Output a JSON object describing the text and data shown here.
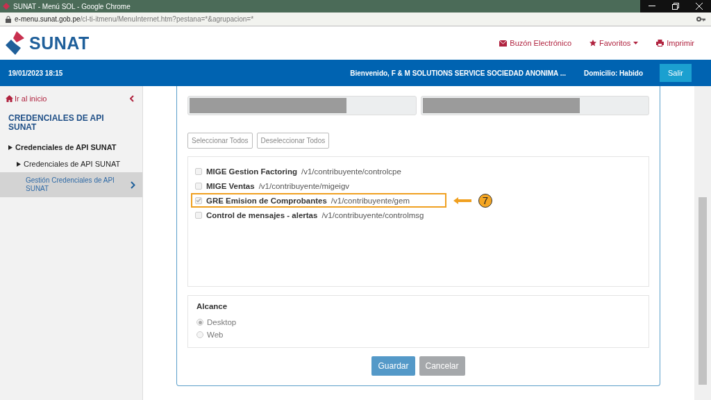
{
  "window": {
    "title": "SUNAT - Menú SOL - Google Chrome",
    "url_host": "e-menu.sunat.gob.pe",
    "url_path": "/cl-ti-itmenu/MenuInternet.htm?pestana=*&agrupacion=*"
  },
  "header": {
    "logo": "SUNAT",
    "links": [
      {
        "kind": "mail",
        "label": "Buzón Electrónico"
      },
      {
        "kind": "star",
        "label": "Favoritos"
      },
      {
        "kind": "print",
        "label": "Imprimir"
      }
    ]
  },
  "bar": {
    "datetime": "19/01/2023 18:15",
    "welcome": "Bienvenido, F & M SOLUTIONS SERVICE SOCIEDAD ANONIMA ...",
    "domicilio": "Domicilio: Habido",
    "logout": "Salir"
  },
  "sidebar": {
    "home": "Ir al inicio",
    "title": "CREDENCIALES DE API SUNAT",
    "items": [
      {
        "label": "Credenciales de API SUNAT",
        "expanded": true,
        "children": [
          {
            "label": "Credenciales de API SUNAT",
            "expanded": true,
            "children": [
              {
                "label": "Gestión Credenciales de API SUNAT",
                "selected": true
              }
            ]
          }
        ]
      }
    ]
  },
  "form": {
    "buttons": [
      "Seleccionar Todos",
      "Deseleccionar Todos"
    ],
    "scopes": [
      {
        "name": "MIGE Gestion Factoring",
        "path": "/v1/contribuyente/controlcpe",
        "checked": false,
        "highlighted": false
      },
      {
        "name": "MIGE Ventas",
        "path": "/v1/contribuyente/migeigv",
        "checked": false,
        "highlighted": false
      },
      {
        "name": "GRE Emision de Comprobantes",
        "path": "/v1/contribuyente/gem",
        "checked": true,
        "highlighted": true
      },
      {
        "name": "Control de mensajes - alertas",
        "path": "/v1/contribuyente/controlmsg",
        "checked": false,
        "highlighted": false
      }
    ],
    "callout": "7",
    "alcance": {
      "title": "Alcance",
      "options": [
        {
          "label": "Desktop",
          "selected": true
        },
        {
          "label": "Web",
          "selected": false
        }
      ]
    },
    "actions": [
      {
        "kind": "primary",
        "label": "Guardar"
      },
      {
        "kind": "secondary",
        "label": "Cancelar"
      }
    ]
  }
}
